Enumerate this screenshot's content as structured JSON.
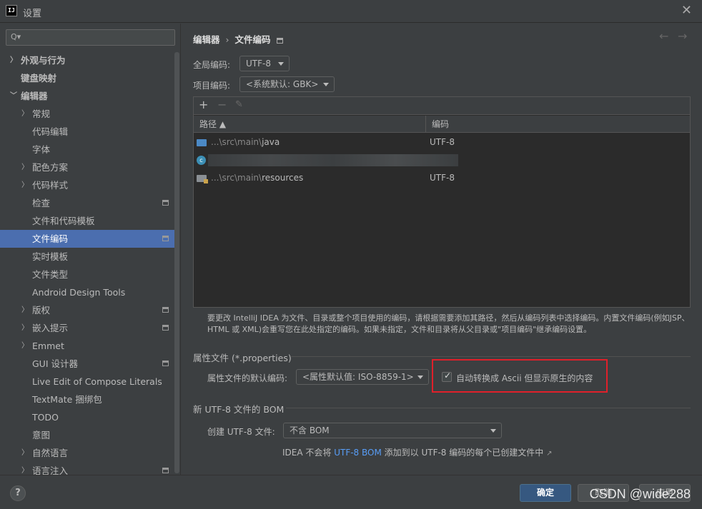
{
  "window": {
    "logo": "IJ",
    "title": "设置",
    "close": "✕"
  },
  "sidebar": {
    "search": {
      "value": "",
      "placeholder": ""
    },
    "items": [
      {
        "label": "外观与行为",
        "arrow": "〉",
        "indent": 0,
        "expanded": false,
        "bold": true
      },
      {
        "label": "键盘映射",
        "arrow": "",
        "indent": 0,
        "bold": true
      },
      {
        "label": "编辑器",
        "arrow": "〉",
        "indent": 0,
        "expanded": true,
        "bold": true
      },
      {
        "label": "常规",
        "arrow": "〉",
        "indent": 1
      },
      {
        "label": "代码编辑",
        "arrow": "",
        "indent": 1
      },
      {
        "label": "字体",
        "arrow": "",
        "indent": 1
      },
      {
        "label": "配色方案",
        "arrow": "〉",
        "indent": 1
      },
      {
        "label": "代码样式",
        "arrow": "〉",
        "indent": 1
      },
      {
        "label": "检查",
        "arrow": "",
        "indent": 1,
        "settings_icon": true
      },
      {
        "label": "文件和代码模板",
        "arrow": "",
        "indent": 1
      },
      {
        "label": "文件编码",
        "arrow": "",
        "indent": 1,
        "selected": true,
        "settings_icon": true
      },
      {
        "label": "实时模板",
        "arrow": "",
        "indent": 1
      },
      {
        "label": "文件类型",
        "arrow": "",
        "indent": 1
      },
      {
        "label": "Android Design Tools",
        "arrow": "",
        "indent": 1
      },
      {
        "label": "版权",
        "arrow": "〉",
        "indent": 1,
        "settings_icon": true
      },
      {
        "label": "嵌入提示",
        "arrow": "〉",
        "indent": 1,
        "settings_icon": true
      },
      {
        "label": "Emmet",
        "arrow": "〉",
        "indent": 1
      },
      {
        "label": "GUI 设计器",
        "arrow": "",
        "indent": 1,
        "settings_icon": true
      },
      {
        "label": "Live Edit of Compose Literals",
        "arrow": "",
        "indent": 1
      },
      {
        "label": "TextMate 捆绑包",
        "arrow": "",
        "indent": 1
      },
      {
        "label": "TODO",
        "arrow": "",
        "indent": 1
      },
      {
        "label": "意图",
        "arrow": "",
        "indent": 1
      },
      {
        "label": "自然语言",
        "arrow": "〉",
        "indent": 1
      },
      {
        "label": "语言注入",
        "arrow": "〉",
        "indent": 1,
        "settings_icon": true
      }
    ]
  },
  "breadcrumb": {
    "parent": "编辑器",
    "separator": "›",
    "current": "文件编码"
  },
  "nav": {
    "back": "←",
    "forward": "→"
  },
  "global_encoding": {
    "label": "全局编码:",
    "value": "UTF-8"
  },
  "project_encoding": {
    "label": "项目编码:",
    "value": "<系统默认: GBK>"
  },
  "table": {
    "toolbar": {
      "add": "+",
      "remove": "−",
      "edit": "✎"
    },
    "headers": {
      "path": "路径 ▲",
      "encoding": "编码"
    },
    "rows": [
      {
        "prefix": "...\\src\\main\\",
        "name": "java",
        "encoding": "UTF-8",
        "icon": "folder-icon"
      },
      {
        "prefix": "",
        "name": "",
        "encoding": "",
        "icon": "class-icon",
        "blurred": true
      },
      {
        "prefix": "...\\src\\main\\",
        "name": "resources",
        "encoding": "UTF-8",
        "icon": "resources-folder-icon"
      }
    ]
  },
  "info_text": {
    "line1": "要更改 IntelliJ IDEA 为文件、目录或整个项目使用的编码，请根据需要添加其路径，然后从编码列表中选择编码。内置文件编码(例如JSP、",
    "line2": "HTML 或 XML)会重写您在此处指定的编码。如果未指定，文件和目录将从父目录或\"项目编码\"继承编码设置。"
  },
  "properties_section": {
    "title": "属性文件 (*.properties)",
    "default_label": "属性文件的默认编码:",
    "default_value": "<属性默认值: ISO-8859-1>",
    "checkbox_label": "自动转换成 Ascii 但显示原生的内容",
    "checkbox_checked": true
  },
  "bom_section": {
    "title": "新 UTF-8 文件的 BOM",
    "create_label": "创建 UTF-8 文件:",
    "create_value": "不含 BOM",
    "note_before": "IDEA 不会将 ",
    "note_link": "UTF-8 BOM",
    "note_after": " 添加到以 UTF-8 编码的每个已创建文件中 ",
    "note_icon": "↗"
  },
  "footer": {
    "help": "?",
    "ok": "确定",
    "cancel": "取消",
    "apply": "应用",
    "watermark": "CSDN @wide288"
  },
  "colors": {
    "accent": "#4b6eaf",
    "primary_button": "#365880",
    "link": "#589df6",
    "highlight_box": "#e0202a",
    "background": "#3c3f41"
  }
}
